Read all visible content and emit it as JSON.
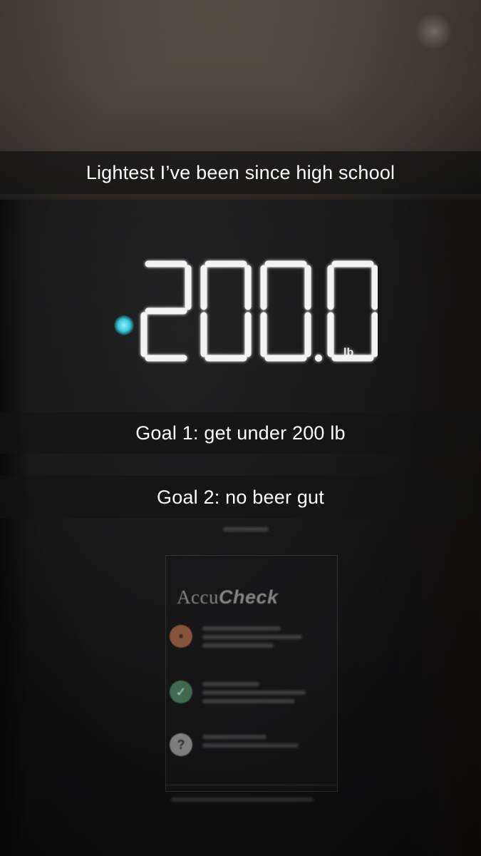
{
  "captions": {
    "top": "Lightest I’ve been since high school",
    "goal1": "Goal 1: get under 200 lb",
    "goal2": "Goal 2: no beer gut"
  },
  "scale_display": {
    "reading": "200.0",
    "unit": "lb"
  },
  "panel": {
    "brand_prefix": "Accu",
    "brand_suffix": "Check",
    "row_icons": [
      "scale-icon",
      "check-icon",
      "question-icon"
    ]
  },
  "colors": {
    "led": "#f4f4f4",
    "indicator_dot": "#44cde0",
    "caption_bar": "#141414"
  }
}
